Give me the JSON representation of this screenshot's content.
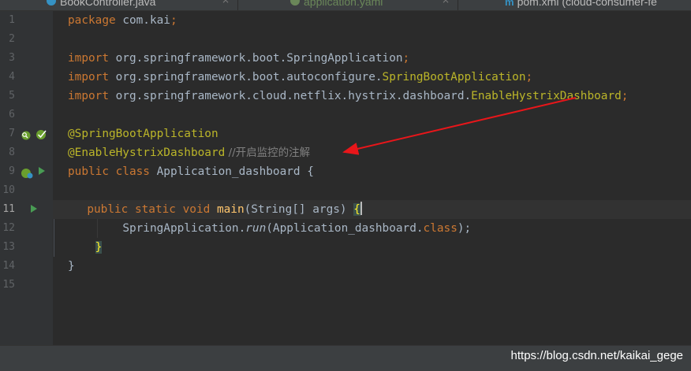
{
  "tabs": [
    {
      "label": "BookController.java",
      "icon": "java-class-icon",
      "active": false
    },
    {
      "label": "application.yaml",
      "icon": "yaml-icon",
      "active": false
    },
    {
      "label": "pom.xml (cloud-consumer-fe",
      "icon": "maven-icon",
      "active": true
    }
  ],
  "gutter": {
    "line_numbers": [
      "1",
      "2",
      "3",
      "4",
      "5",
      "6",
      "7",
      "8",
      "9",
      "10",
      "11",
      "12",
      "13",
      "14",
      "15"
    ],
    "current_line": "11"
  },
  "code": {
    "l1": {
      "kw": "package",
      "rest": " com.kai",
      "semi": ";"
    },
    "l3": {
      "kw": "import",
      "plain": " org.springframework.boot.",
      "hl": "SpringApplication",
      "semi": ";"
    },
    "l4": {
      "kw": "import",
      "plain": " org.springframework.boot.autoconfigure.",
      "hl": "SpringBootApplication",
      "semi": ";"
    },
    "l5": {
      "kw": "import",
      "plain": " org.springframework.cloud.netflix.hystrix.dashboard.",
      "hl": "EnableHystrixDashboard",
      "semi": ";"
    },
    "l7": {
      "ann": "@SpringBootApplication"
    },
    "l8": {
      "ann": "@EnableHystrixDashboard",
      "comment": " //开启监控的注解"
    },
    "l9": {
      "kw": "public class",
      "rest": " Application_dashboard {"
    },
    "l11": {
      "kw": "public static void",
      "fn": "main",
      "args": "(String[] args) ",
      "brace": "{"
    },
    "l12": {
      "plain": "SpringApplication.",
      "method": "run",
      "args": "(Application_dashboard.",
      "kw": "class",
      "end": ");"
    },
    "l13": {
      "brace": "}"
    },
    "l14": {
      "brace": "}"
    }
  },
  "watermark": "https://blog.csdn.net/kaikai_gege",
  "colors": {
    "background": "#2b2b2b",
    "keyword": "#cc7832",
    "annotation": "#bbb529",
    "comment": "#808080",
    "method": "#ffc66d",
    "arrow": "#e8161a"
  }
}
